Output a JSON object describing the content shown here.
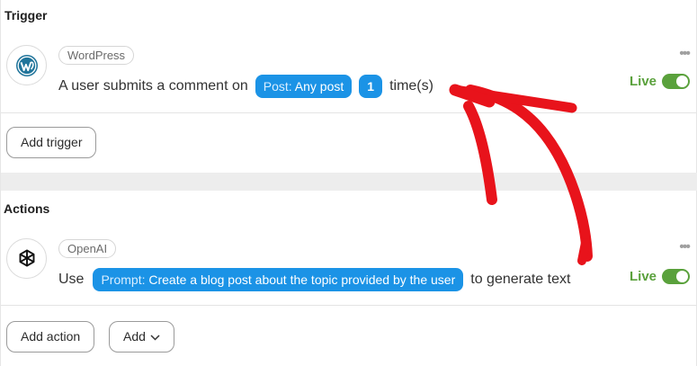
{
  "trigger": {
    "section_title": "Trigger",
    "app_chip": "WordPress",
    "app_icon": "wordpress-icon",
    "sentence_prefix": "A user submits a comment on",
    "pill_key": "Post:",
    "pill_value": "Any post",
    "count": "1",
    "sentence_suffix": "time(s)",
    "status_label": "Live",
    "more": "•••",
    "add_button": "Add trigger"
  },
  "actions": {
    "section_title": "Actions",
    "app_chip": "OpenAI",
    "app_icon": "openai-icon",
    "sentence_prefix": "Use",
    "pill_key": "Prompt:",
    "pill_value": "Create a blog post about the topic provided by the user",
    "sentence_suffix": "to generate text",
    "status_label": "Live",
    "more": "•••",
    "add_action_button": "Add action",
    "add_dropdown_button": "Add"
  },
  "colors": {
    "pill": "#1b93e6",
    "live": "#5aa13c",
    "arrow": "#e8131b"
  }
}
